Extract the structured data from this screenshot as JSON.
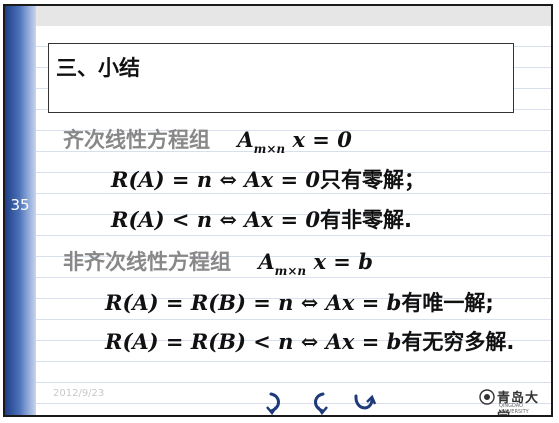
{
  "slide": {
    "number": "35",
    "date": "2012/9/23"
  },
  "title": "三、小结",
  "homogeneous": {
    "label": "齐次线性方程组",
    "equation_main": "A",
    "equation_sub": "m×n",
    "equation_tail": " x = 0",
    "case1_math": "R(A) = n ⇔ Ax = 0",
    "case1_text": "只有零解；",
    "case2_math": "R(A) < n ⇔ Ax = 0",
    "case2_text": "有非零解."
  },
  "nonhomogeneous": {
    "label": "非齐次线性方程组",
    "equation_main": "A",
    "equation_sub": "m×n",
    "equation_tail": " x = b",
    "case1_math": "R(A) = R(B) = n ⇔ Ax = b",
    "case1_text": "有唯一解;",
    "case2_math": "R(A) = R(B) < n ⇔ Ax = b",
    "case2_text": "有无穷多解."
  },
  "nav": {
    "icons": [
      "next-arrow-icon",
      "previous-arrow-icon",
      "return-arrow-icon"
    ]
  },
  "logo": {
    "text": "青岛大学",
    "small_text": "QINGDAO UNIVERSITY"
  },
  "colors": {
    "sidebar": "#2e4f9a",
    "gray_text": "#888888",
    "nav_icon": "#1f3a7a"
  }
}
